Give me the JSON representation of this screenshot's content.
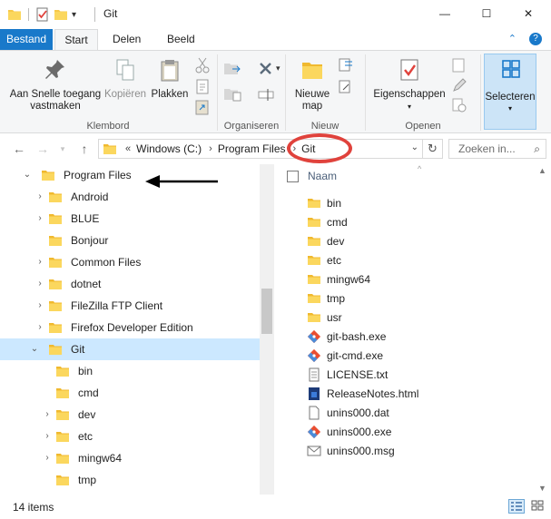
{
  "window": {
    "title": "Git",
    "controls": {
      "minimize": "—",
      "maximize": "☐",
      "close": "✕"
    }
  },
  "ribbon_tabs": [
    {
      "label": "Bestand"
    },
    {
      "label": "Start"
    },
    {
      "label": "Delen"
    },
    {
      "label": "Beeld"
    }
  ],
  "ribbon": {
    "pin_label": "Aan Snelle toegang\nvastmaken",
    "copy_label": "Kopiëren",
    "paste_label": "Plakken",
    "clipboard_group": "Klembord",
    "organize_group": "Organiseren",
    "new_folder_label": "Nieuwe\nmap",
    "new_group": "Nieuw",
    "properties_label": "Eigenschappen",
    "open_group": "Openen",
    "select_label": "Selecteren"
  },
  "address": {
    "prefix": "«",
    "crumbs": [
      "Windows (C:)",
      "Program Files",
      "Git"
    ],
    "search_placeholder": "Zoeken in..."
  },
  "nav_tree": [
    {
      "label": "Program Files",
      "level": 0,
      "expanded": true,
      "selected": false
    },
    {
      "label": "Android",
      "level": 1,
      "expanded": false,
      "selected": false
    },
    {
      "label": "BLUE",
      "level": 1,
      "expanded": false,
      "selected": false
    },
    {
      "label": "Bonjour",
      "level": 1,
      "expanded": null,
      "selected": false
    },
    {
      "label": "Common Files",
      "level": 1,
      "expanded": false,
      "selected": false
    },
    {
      "label": "dotnet",
      "level": 1,
      "expanded": false,
      "selected": false
    },
    {
      "label": "FileZilla FTP Client",
      "level": 1,
      "expanded": false,
      "selected": false
    },
    {
      "label": "Firefox Developer Edition",
      "level": 1,
      "expanded": false,
      "selected": false
    },
    {
      "label": "Git",
      "level": 1,
      "expanded": true,
      "selected": true
    },
    {
      "label": "bin",
      "level": 2,
      "expanded": null,
      "selected": false
    },
    {
      "label": "cmd",
      "level": 2,
      "expanded": null,
      "selected": false
    },
    {
      "label": "dev",
      "level": 2,
      "expanded": false,
      "selected": false
    },
    {
      "label": "etc",
      "level": 2,
      "expanded": false,
      "selected": false
    },
    {
      "label": "mingw64",
      "level": 2,
      "expanded": false,
      "selected": false
    },
    {
      "label": "tmp",
      "level": 2,
      "expanded": null,
      "selected": false
    }
  ],
  "content": {
    "column_name": "Naam",
    "files": [
      {
        "name": "bin",
        "icon": "folder-icon"
      },
      {
        "name": "cmd",
        "icon": "folder-icon"
      },
      {
        "name": "dev",
        "icon": "folder-icon"
      },
      {
        "name": "etc",
        "icon": "folder-icon"
      },
      {
        "name": "mingw64",
        "icon": "folder-icon"
      },
      {
        "name": "tmp",
        "icon": "folder-icon"
      },
      {
        "name": "usr",
        "icon": "folder-icon"
      },
      {
        "name": "git-bash.exe",
        "icon": "git-exe-icon"
      },
      {
        "name": "git-cmd.exe",
        "icon": "git-exe-icon"
      },
      {
        "name": "LICENSE.txt",
        "icon": "text-file-icon"
      },
      {
        "name": "ReleaseNotes.html",
        "icon": "html-file-icon"
      },
      {
        "name": "unins000.dat",
        "icon": "blank-file-icon"
      },
      {
        "name": "unins000.exe",
        "icon": "git-exe-icon"
      },
      {
        "name": "unins000.msg",
        "icon": "msg-file-icon"
      }
    ]
  },
  "status": {
    "item_count": "14 items"
  },
  "colors": {
    "accent": "#1979ca",
    "folder": "#f7c948",
    "selection": "#cce8ff",
    "highlight_ellipse": "#e0423c"
  }
}
